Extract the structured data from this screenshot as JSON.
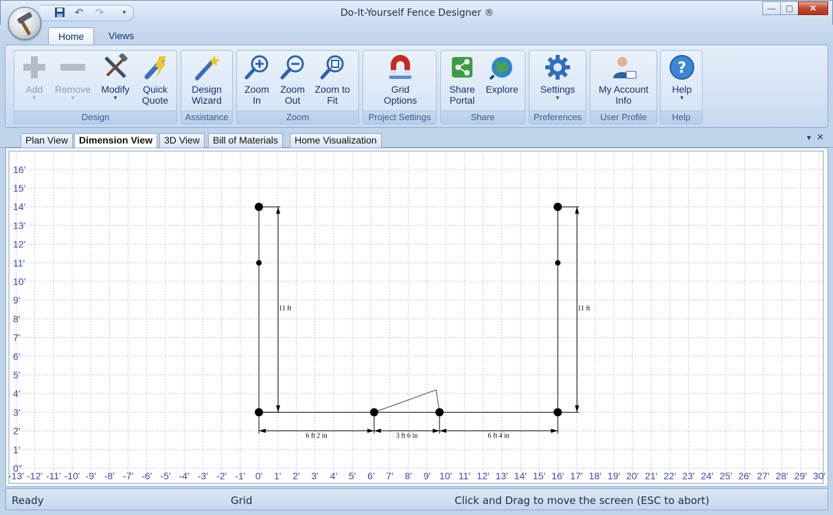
{
  "window": {
    "title": "Do-It-Yourself Fence Designer ®",
    "min_glyph": "—",
    "max_glyph": "▢",
    "close_glyph": "✕"
  },
  "qat": {
    "icons": [
      "save-icon",
      "undo-icon",
      "redo-icon",
      "customize-dropdown-icon"
    ]
  },
  "ribbon_tabs": [
    "Home",
    "Views"
  ],
  "ribbon": {
    "groups": [
      {
        "label": "Design",
        "buttons": [
          {
            "label": "Add",
            "icon": "add-icon",
            "disabled": true,
            "dropdown": true
          },
          {
            "label": "Remove",
            "icon": "remove-icon",
            "disabled": true,
            "dropdown": true
          },
          {
            "label": "Modify",
            "icon": "hammer-wrench-icon",
            "disabled": false,
            "dropdown": true
          },
          {
            "label": "Quick\nQuote",
            "icon": "quick-quote-icon",
            "disabled": false,
            "dropdown": false
          }
        ]
      },
      {
        "label": "Assistance",
        "buttons": [
          {
            "label": "Design\nWizard",
            "icon": "magic-wand-icon",
            "disabled": false,
            "dropdown": false
          }
        ]
      },
      {
        "label": "Zoom",
        "buttons": [
          {
            "label": "Zoom\nIn",
            "icon": "zoom-in-icon",
            "disabled": false,
            "dropdown": false
          },
          {
            "label": "Zoom\nOut",
            "icon": "zoom-out-icon",
            "disabled": false,
            "dropdown": false
          },
          {
            "label": "Zoom to\nFit",
            "icon": "zoom-fit-icon",
            "disabled": false,
            "dropdown": false
          }
        ]
      },
      {
        "label": "Project Settings",
        "buttons": [
          {
            "label": "Grid\nOptions",
            "icon": "magnet-grid-icon",
            "disabled": false,
            "dropdown": false
          }
        ]
      },
      {
        "label": "Share",
        "buttons": [
          {
            "label": "Share\nPortal",
            "icon": "share-portal-icon",
            "disabled": false,
            "dropdown": false
          },
          {
            "label": "Explore",
            "icon": "globe-icon",
            "disabled": false,
            "dropdown": false
          }
        ]
      },
      {
        "label": "Preferences",
        "buttons": [
          {
            "label": "Settings",
            "icon": "gear-icon",
            "disabled": false,
            "dropdown": true
          }
        ]
      },
      {
        "label": "User Profile",
        "buttons": [
          {
            "label": "My Account\nInfo",
            "icon": "account-icon",
            "disabled": false,
            "dropdown": false
          }
        ]
      },
      {
        "label": "Help",
        "buttons": [
          {
            "label": "Help",
            "icon": "help-icon",
            "disabled": false,
            "dropdown": true
          }
        ]
      }
    ]
  },
  "doc_tabs": [
    "Plan View",
    "Dimension View",
    "3D View",
    "Bill of Materials",
    "Home Visualization"
  ],
  "active_doc_tab": "Dimension View",
  "tab_controls": {
    "menu": "▼",
    "close": "✕"
  },
  "drawing": {
    "x_labels": [
      "-13'",
      "-12'",
      "-11'",
      "-10'",
      "-9'",
      "-8'",
      "-7'",
      "-6'",
      "-5'",
      "-4'",
      "-3'",
      "-2'",
      "-1'",
      "0'",
      "1'",
      "2'",
      "3'",
      "4'",
      "5'",
      "6'",
      "7'",
      "8'",
      "9'",
      "10'",
      "11'",
      "12'",
      "13'",
      "14'",
      "15'",
      "16'",
      "17'",
      "18'",
      "19'",
      "20'",
      "21'",
      "22'",
      "23'",
      "24'",
      "25'",
      "26'",
      "27'",
      "28'",
      "29'",
      "30'"
    ],
    "y_labels": [
      "0\"",
      "1'",
      "2'",
      "3'",
      "4'",
      "5'",
      "6'",
      "7'",
      "8'",
      "9'",
      "10'",
      "11'",
      "12'",
      "13'",
      "14'",
      "15'",
      "16'"
    ],
    "dimension_labels": [
      "11 ft",
      "11 ft",
      "6 ft 2 in",
      "3 ft 6 in",
      "6 ft 4 in"
    ],
    "colors": {
      "grid": "#8a8fd6",
      "axis_label": "#3b4a9c",
      "fence": "#000000"
    }
  },
  "status": {
    "left": "Ready",
    "middle": "Grid",
    "right": "Click and Drag to move the screen  (ESC to abort)"
  }
}
